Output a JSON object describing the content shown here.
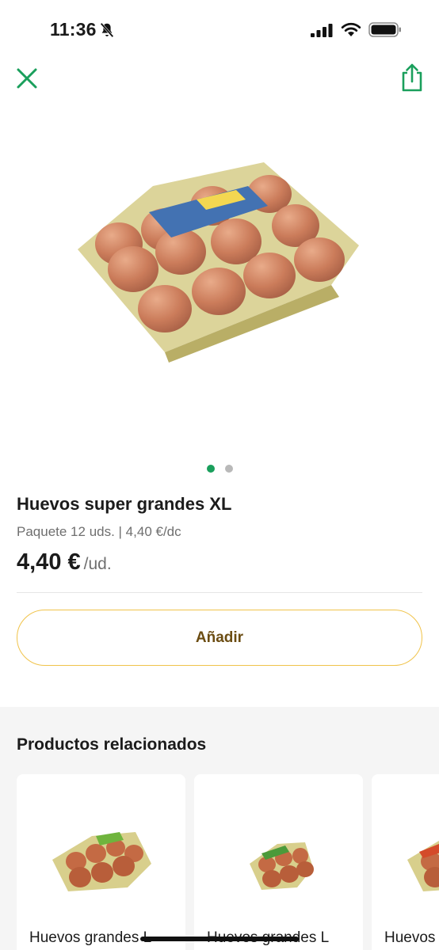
{
  "status_bar": {
    "time": "11:36"
  },
  "header": {
    "close_icon": "close-x-icon",
    "share_icon": "share-icon",
    "accent_color": "#1a9f5c"
  },
  "gallery": {
    "image_count": 2,
    "active_index": 0
  },
  "product": {
    "title": "Huevos super grandes XL",
    "subtitle": "Paquete 12 uds. | 4,40 €/dc",
    "price": "4,40 €",
    "price_unit": "/ud."
  },
  "add_button": {
    "label": "Añadir",
    "border_color": "#f0c34a"
  },
  "related": {
    "title": "Productos relacionados",
    "items": [
      {
        "name": "Huevos grandes L"
      },
      {
        "name": "Huevos grandes L"
      },
      {
        "name": "Huevos"
      }
    ]
  }
}
